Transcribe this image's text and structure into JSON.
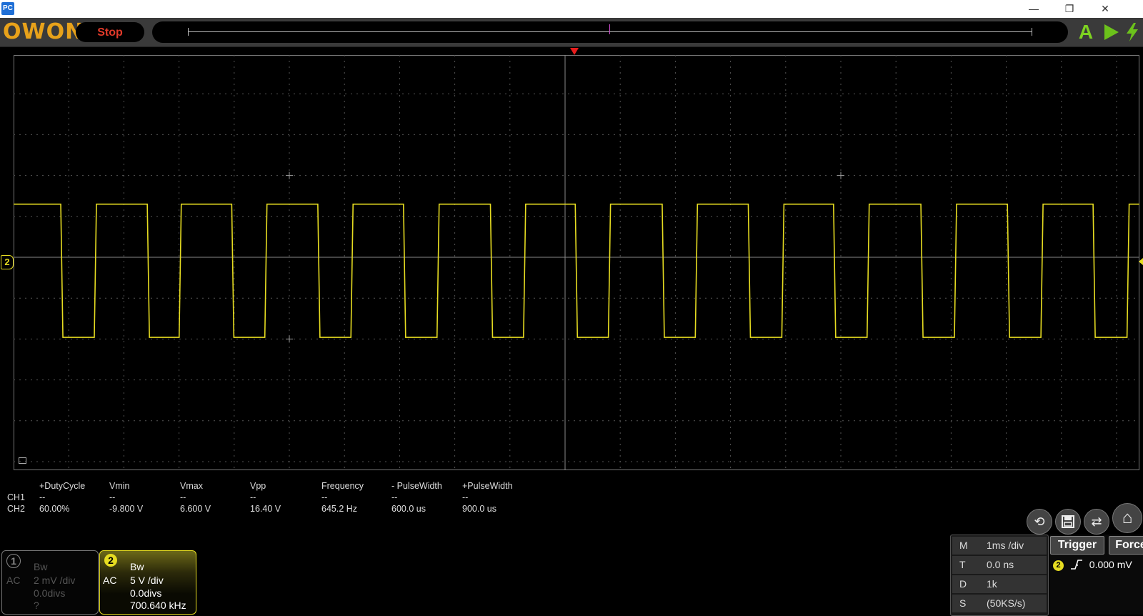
{
  "titlebar": {
    "app_icon": "PC",
    "minimize": "—",
    "restore": "❐",
    "close": "✕"
  },
  "toolbar": {
    "logo": "OWON",
    "stop_label": "Stop",
    "auto_label": "A",
    "run_icon": "play-icon",
    "force_icon": "lightning-icon"
  },
  "colors": {
    "trace": "#e6dc21",
    "grid": "#555555",
    "stop": "#e23a2a",
    "logo": "#e8a21a"
  },
  "measurements": {
    "headers": [
      "+DutyCycle",
      "Vmin",
      "Vmax",
      "Vpp",
      "Frequency",
      "- PulseWidth",
      "+PulseWidth"
    ],
    "rows": [
      {
        "channel": "CH1",
        "values": [
          "--",
          "--",
          "--",
          "--",
          "--",
          "--",
          "--"
        ]
      },
      {
        "channel": "CH2",
        "values": [
          "60.00%",
          "-9.800 V",
          "6.600 V",
          "16.40 V",
          "645.2 Hz",
          "600.0 us",
          "900.0 us"
        ]
      }
    ]
  },
  "ch1": {
    "number": "1",
    "bw": "Bw",
    "coupling": "AC",
    "scale": "2 mV /div",
    "offset": "0.0divs",
    "freq": "?"
  },
  "ch2": {
    "number": "2",
    "bw": "Bw",
    "coupling": "AC",
    "scale": "5 V /div",
    "offset": "0.0divs",
    "freq": "700.640 kHz",
    "ground_marker": "2"
  },
  "timebase": {
    "rows": [
      {
        "key": "M",
        "value": "1ms /div"
      },
      {
        "key": "T",
        "value": "0.0 ns"
      },
      {
        "key": "D",
        "value": "1k"
      },
      {
        "key": "S",
        "value": "(50KS/s)"
      }
    ]
  },
  "trigger": {
    "trigger_label": "Trigger",
    "force_label": "Force",
    "source": "2",
    "level": "0.000 mV"
  },
  "chart_data": {
    "type": "line",
    "title": "",
    "xlabel": "",
    "ylabel": "",
    "grid": true,
    "x_divisions": 14,
    "y_divisions": 10,
    "series": [
      {
        "name": "",
        "waveform": "square",
        "high_div": 1.3,
        "low_div": -1.96,
        "edges_div": [
          1.14,
          1.95,
          3.23,
          4.0,
          5.27,
          6.07,
          7.35,
          8.15,
          9.42,
          10.23,
          11.52,
          12.32,
          13.57,
          14.37,
          15.67,
          16.47,
          17.75,
          18.56,
          19.81,
          20.62,
          21.92,
          22.73,
          24.01,
          24.82,
          26.08,
          26.9
        ]
      }
    ]
  }
}
